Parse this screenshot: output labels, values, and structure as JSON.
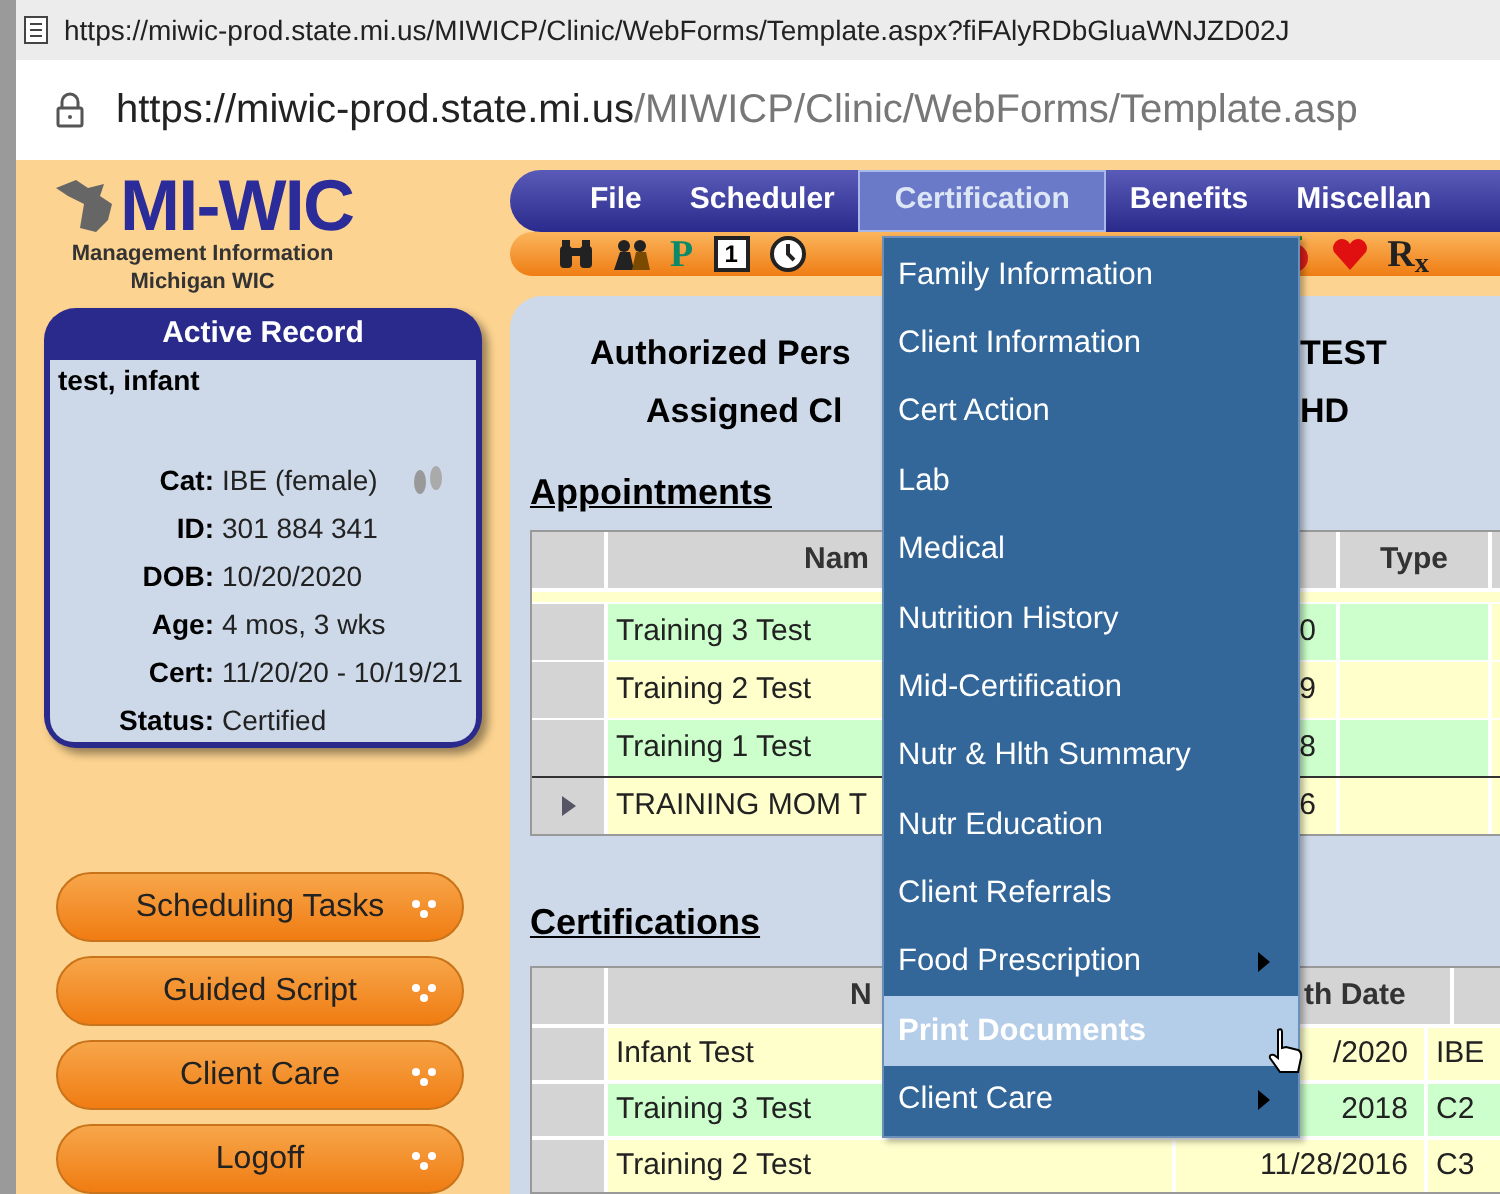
{
  "browser": {
    "tab_url": "https://miwic-prod.state.mi.us/MIWICP/Clinic/WebForms/Template.aspx?fiFAlyRDbGluaWNJZD02J",
    "address_host": "https://miwic-prod.state.mi.us",
    "address_path": "/MIWICP/Clinic/WebForms/Template.asp"
  },
  "logo": {
    "title": "MI-WIC",
    "subtitle_1": "Management Information",
    "subtitle_2": "Michigan WIC"
  },
  "active_record": {
    "title": "Active Record",
    "name": "test, infant",
    "fields": [
      {
        "label": "Cat:",
        "value": "IBE (female)",
        "kind": "category"
      },
      {
        "label": "ID:",
        "value": "301 884 341",
        "kind": "text"
      },
      {
        "label": "DOB:",
        "value": "10/20/2020",
        "kind": "text"
      },
      {
        "label": "Age:",
        "value": "4 mos, 3 wks",
        "kind": "text"
      },
      {
        "label": "Cert:",
        "value": "11/20/20 - 10/19/21",
        "kind": "text"
      },
      {
        "label": "Status:",
        "value": "Certified",
        "kind": "text"
      }
    ]
  },
  "side_buttons": [
    "Scheduling Tasks",
    "Guided Script",
    "Client Care",
    "Logoff"
  ],
  "menu": [
    {
      "label": "File",
      "selected": false
    },
    {
      "label": "Scheduler",
      "selected": false
    },
    {
      "label": "Certification",
      "selected": true
    },
    {
      "label": "Benefits",
      "selected": false
    },
    {
      "label": "Miscellan",
      "selected": false
    }
  ],
  "toolbar_left": [
    {
      "kind": "binoculars"
    },
    {
      "kind": "people"
    },
    {
      "kind": "letter",
      "label": "P"
    },
    {
      "kind": "calendar",
      "label": "1"
    },
    {
      "kind": "clock"
    }
  ],
  "toolbar_right": [
    {
      "kind": "apple"
    },
    {
      "kind": "heart"
    },
    {
      "kind": "letter",
      "label": "R$_{x}$"
    }
  ],
  "header_lines": [
    {
      "left": "Authorized Pers",
      "right": "TEST"
    },
    {
      "left": "Assigned Cl",
      "right": "HD"
    }
  ],
  "appointments": {
    "title": "Appointments",
    "columns": [
      "Nam",
      "",
      "Type"
    ],
    "rows": [
      {
        "name": "Training 3 Test",
        "date": "0",
        "current": false
      },
      {
        "name": "Training 2 Test",
        "date": "9",
        "current": false
      },
      {
        "name": "Training 1 Test",
        "date": "8",
        "current": false
      },
      {
        "name": "TRAINING MOM T",
        "date": "6",
        "current": true
      }
    ]
  },
  "certifications": {
    "title": "Certifications",
    "columns": [
      "N",
      "th Date"
    ],
    "rows": [
      {
        "name": "Infant Test",
        "date": "/2020",
        "category": "IBE"
      },
      {
        "name": "Training 3 Test",
        "date": "2018",
        "category": "C2"
      },
      {
        "name": "Training 2 Test",
        "date": "11/28/2016",
        "category": "C3"
      }
    ]
  },
  "dropdown": [
    {
      "label": "Family Information",
      "submenu": false,
      "selected": false
    },
    {
      "label": "Client Information",
      "submenu": false,
      "selected": false
    },
    {
      "label": "Cert Action",
      "submenu": false,
      "selected": false
    },
    {
      "label": "Lab",
      "submenu": false,
      "selected": false
    },
    {
      "label": "Medical",
      "submenu": false,
      "selected": false
    },
    {
      "label": "Nutrition History",
      "submenu": false,
      "selected": false
    },
    {
      "label": "Mid-Certification",
      "submenu": false,
      "selected": false
    },
    {
      "label": "Nutr & Hlth Summary",
      "submenu": false,
      "selected": false
    },
    {
      "label": "Nutr Education",
      "submenu": false,
      "selected": false
    },
    {
      "label": "Client Referrals",
      "submenu": false,
      "selected": false
    },
    {
      "label": "Food Prescription",
      "submenu": true,
      "selected": false
    },
    {
      "label": "Print Documents",
      "submenu": false,
      "selected": true
    },
    {
      "label": "Client Care",
      "submenu": true,
      "selected": false
    }
  ]
}
